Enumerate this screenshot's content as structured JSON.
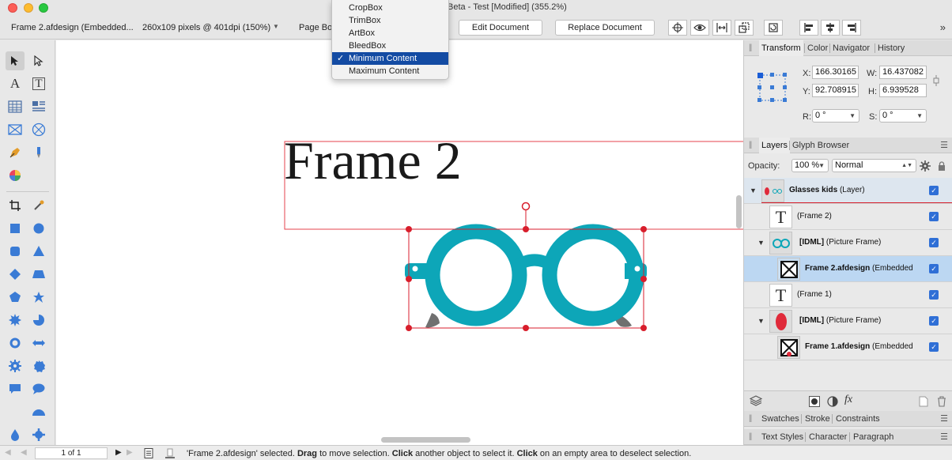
{
  "window": {
    "title": "Beta - Test [Modified] (355.2%)"
  },
  "context_bar": {
    "document_name": "Frame 2.afdesign (Embedded...",
    "dimensions": "260x109 pixels @ 401dpi (150%)",
    "page_box_label": "Page Box",
    "edit_document_label": "Edit Document",
    "replace_document_label": "Replace Document"
  },
  "page_box_menu": {
    "items": [
      "CropBox",
      "TrimBox",
      "ArtBox",
      "BleedBox",
      "Minimum Content",
      "Maximum Content"
    ],
    "selected": "Minimum Content",
    "checkmark": "✓"
  },
  "canvas": {
    "frame_text": "Frame 2",
    "colors": {
      "glasses": "#0da6b8",
      "selection": "#d81e2c",
      "frame_outline": "#e5434e",
      "ear_pieces": "#707070"
    }
  },
  "transform_panel": {
    "tabs": [
      "Transform",
      "Color",
      "Navigator",
      "History"
    ],
    "active_tab": "Transform",
    "x_label": "X:",
    "x_value": "166.30165",
    "y_label": "Y:",
    "y_value": "92.708915",
    "w_label": "W:",
    "w_value": "16.437082",
    "h_label": "H:",
    "h_value": "6.939528",
    "r_label": "R:",
    "r_value": "0 °",
    "s_label": "S:",
    "s_value": "0 °"
  },
  "layers_panel": {
    "tabs": [
      "Layers",
      "Glyph Browser"
    ],
    "active_tab": "Layers",
    "opacity_label": "Opacity:",
    "opacity_value": "100 %",
    "blend_mode": "Normal",
    "layers": [
      {
        "name": "Glasses kids",
        "suffix": "(Layer)",
        "bold": true
      },
      {
        "name": "",
        "suffix": "(Frame 2)",
        "bold": false
      },
      {
        "name": "[IDML]",
        "suffix": "(Picture Frame)",
        "bold": true
      },
      {
        "name": "Frame 2.afdesign",
        "suffix": "(Embedded",
        "bold": true
      },
      {
        "name": "",
        "suffix": "(Frame 1)",
        "bold": false
      },
      {
        "name": "[IDML]",
        "suffix": "(Picture Frame)",
        "bold": true
      },
      {
        "name": "Frame 1.afdesign",
        "suffix": "(Embedded",
        "bold": true
      }
    ],
    "fx_label": "fx"
  },
  "collapsed_panels": {
    "swatches_tabs": [
      "Swatches",
      "Stroke",
      "Constraints"
    ],
    "text_tabs": [
      "Text Styles",
      "Character",
      "Paragraph"
    ]
  },
  "status_bar": {
    "page_indicator": "1 of 1",
    "msg_1": "'Frame 2.afdesign' selected. ",
    "msg_drag": "Drag",
    "msg_2": " to move selection. ",
    "msg_click": "Click",
    "msg_3": " another object to select it. ",
    "msg_click2": "Click",
    "msg_4": " on an empty area to deselect selection."
  }
}
